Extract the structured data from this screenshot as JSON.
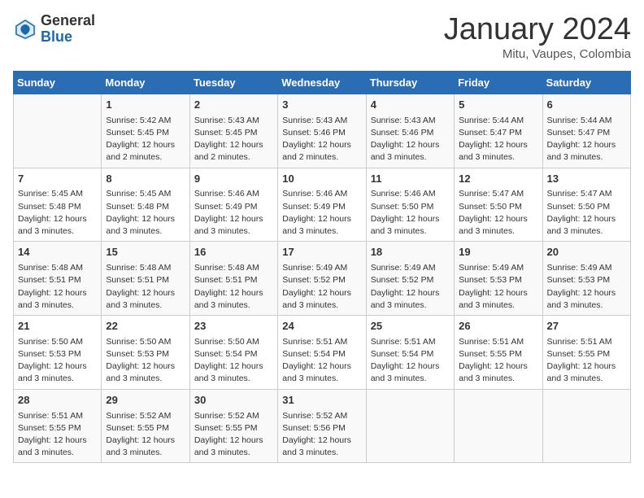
{
  "logo": {
    "general": "General",
    "blue": "Blue"
  },
  "header": {
    "title": "January 2024",
    "subtitle": "Mitu, Vaupes, Colombia"
  },
  "weekdays": [
    "Sunday",
    "Monday",
    "Tuesday",
    "Wednesday",
    "Thursday",
    "Friday",
    "Saturday"
  ],
  "weeks": [
    [
      {
        "day": "",
        "info": ""
      },
      {
        "day": "1",
        "info": "Sunrise: 5:42 AM\nSunset: 5:45 PM\nDaylight: 12 hours\nand 2 minutes."
      },
      {
        "day": "2",
        "info": "Sunrise: 5:43 AM\nSunset: 5:45 PM\nDaylight: 12 hours\nand 2 minutes."
      },
      {
        "day": "3",
        "info": "Sunrise: 5:43 AM\nSunset: 5:46 PM\nDaylight: 12 hours\nand 2 minutes."
      },
      {
        "day": "4",
        "info": "Sunrise: 5:43 AM\nSunset: 5:46 PM\nDaylight: 12 hours\nand 3 minutes."
      },
      {
        "day": "5",
        "info": "Sunrise: 5:44 AM\nSunset: 5:47 PM\nDaylight: 12 hours\nand 3 minutes."
      },
      {
        "day": "6",
        "info": "Sunrise: 5:44 AM\nSunset: 5:47 PM\nDaylight: 12 hours\nand 3 minutes."
      }
    ],
    [
      {
        "day": "7",
        "info": "Sunrise: 5:45 AM\nSunset: 5:48 PM\nDaylight: 12 hours\nand 3 minutes."
      },
      {
        "day": "8",
        "info": "Sunrise: 5:45 AM\nSunset: 5:48 PM\nDaylight: 12 hours\nand 3 minutes."
      },
      {
        "day": "9",
        "info": "Sunrise: 5:46 AM\nSunset: 5:49 PM\nDaylight: 12 hours\nand 3 minutes."
      },
      {
        "day": "10",
        "info": "Sunrise: 5:46 AM\nSunset: 5:49 PM\nDaylight: 12 hours\nand 3 minutes."
      },
      {
        "day": "11",
        "info": "Sunrise: 5:46 AM\nSunset: 5:50 PM\nDaylight: 12 hours\nand 3 minutes."
      },
      {
        "day": "12",
        "info": "Sunrise: 5:47 AM\nSunset: 5:50 PM\nDaylight: 12 hours\nand 3 minutes."
      },
      {
        "day": "13",
        "info": "Sunrise: 5:47 AM\nSunset: 5:50 PM\nDaylight: 12 hours\nand 3 minutes."
      }
    ],
    [
      {
        "day": "14",
        "info": "Sunrise: 5:48 AM\nSunset: 5:51 PM\nDaylight: 12 hours\nand 3 minutes."
      },
      {
        "day": "15",
        "info": "Sunrise: 5:48 AM\nSunset: 5:51 PM\nDaylight: 12 hours\nand 3 minutes."
      },
      {
        "day": "16",
        "info": "Sunrise: 5:48 AM\nSunset: 5:51 PM\nDaylight: 12 hours\nand 3 minutes."
      },
      {
        "day": "17",
        "info": "Sunrise: 5:49 AM\nSunset: 5:52 PM\nDaylight: 12 hours\nand 3 minutes."
      },
      {
        "day": "18",
        "info": "Sunrise: 5:49 AM\nSunset: 5:52 PM\nDaylight: 12 hours\nand 3 minutes."
      },
      {
        "day": "19",
        "info": "Sunrise: 5:49 AM\nSunset: 5:53 PM\nDaylight: 12 hours\nand 3 minutes."
      },
      {
        "day": "20",
        "info": "Sunrise: 5:49 AM\nSunset: 5:53 PM\nDaylight: 12 hours\nand 3 minutes."
      }
    ],
    [
      {
        "day": "21",
        "info": "Sunrise: 5:50 AM\nSunset: 5:53 PM\nDaylight: 12 hours\nand 3 minutes."
      },
      {
        "day": "22",
        "info": "Sunrise: 5:50 AM\nSunset: 5:53 PM\nDaylight: 12 hours\nand 3 minutes."
      },
      {
        "day": "23",
        "info": "Sunrise: 5:50 AM\nSunset: 5:54 PM\nDaylight: 12 hours\nand 3 minutes."
      },
      {
        "day": "24",
        "info": "Sunrise: 5:51 AM\nSunset: 5:54 PM\nDaylight: 12 hours\nand 3 minutes."
      },
      {
        "day": "25",
        "info": "Sunrise: 5:51 AM\nSunset: 5:54 PM\nDaylight: 12 hours\nand 3 minutes."
      },
      {
        "day": "26",
        "info": "Sunrise: 5:51 AM\nSunset: 5:55 PM\nDaylight: 12 hours\nand 3 minutes."
      },
      {
        "day": "27",
        "info": "Sunrise: 5:51 AM\nSunset: 5:55 PM\nDaylight: 12 hours\nand 3 minutes."
      }
    ],
    [
      {
        "day": "28",
        "info": "Sunrise: 5:51 AM\nSunset: 5:55 PM\nDaylight: 12 hours\nand 3 minutes."
      },
      {
        "day": "29",
        "info": "Sunrise: 5:52 AM\nSunset: 5:55 PM\nDaylight: 12 hours\nand 3 minutes."
      },
      {
        "day": "30",
        "info": "Sunrise: 5:52 AM\nSunset: 5:55 PM\nDaylight: 12 hours\nand 3 minutes."
      },
      {
        "day": "31",
        "info": "Sunrise: 5:52 AM\nSunset: 5:56 PM\nDaylight: 12 hours\nand 3 minutes."
      },
      {
        "day": "",
        "info": ""
      },
      {
        "day": "",
        "info": ""
      },
      {
        "day": "",
        "info": ""
      }
    ]
  ]
}
